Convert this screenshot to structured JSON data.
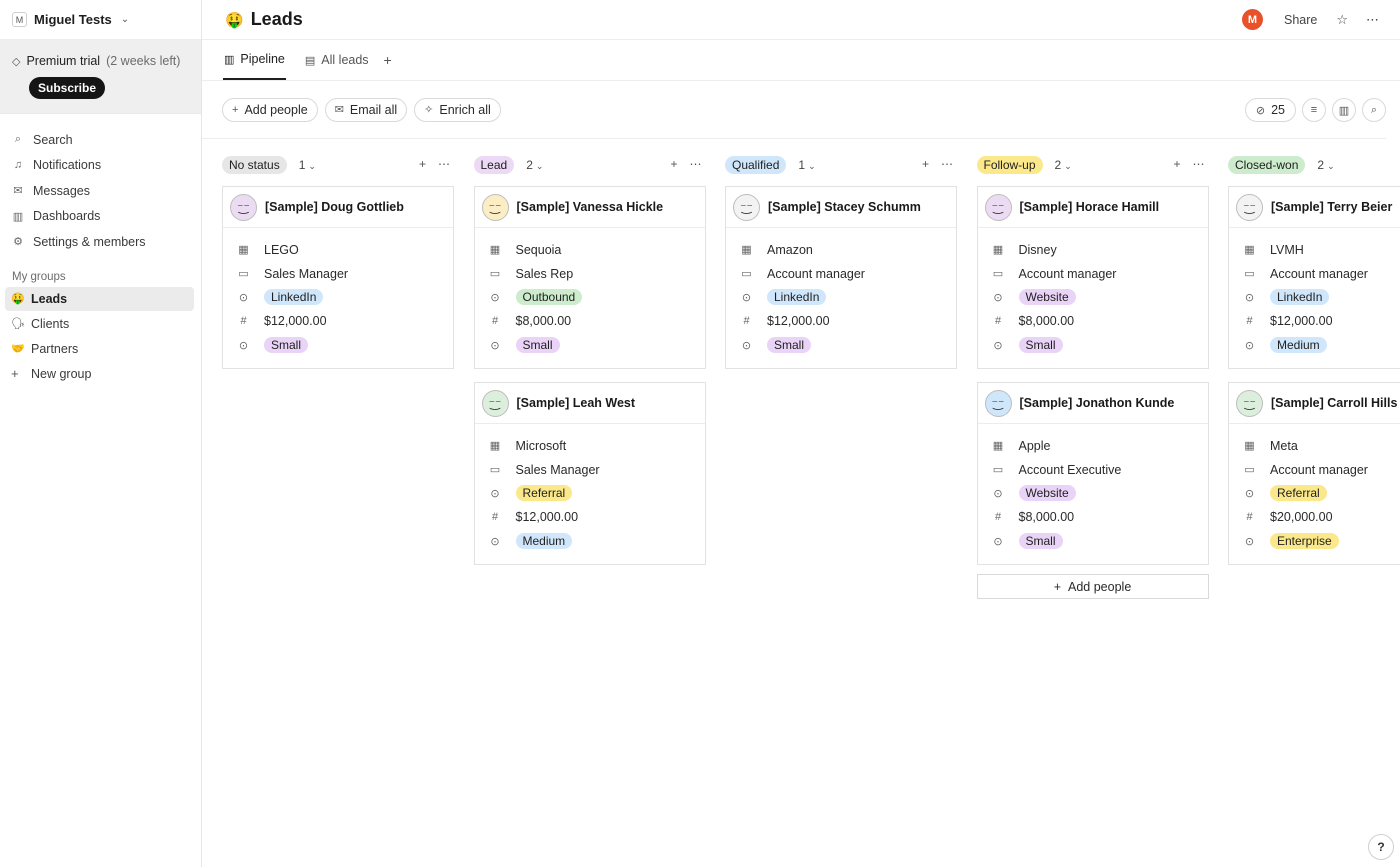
{
  "workspace": {
    "name": "Miguel Tests",
    "badge": "M"
  },
  "trial": {
    "label": "Premium trial",
    "remaining": "(2 weeks left)",
    "subscribe": "Subscribe"
  },
  "nav": [
    {
      "label": "Search",
      "icon": "search-icon",
      "glyph": "⌕"
    },
    {
      "label": "Notifications",
      "icon": "bell-icon",
      "glyph": "🔔︎"
    },
    {
      "label": "Messages",
      "icon": "mail-icon",
      "glyph": "✉"
    },
    {
      "label": "Dashboards",
      "icon": "chart-icon",
      "glyph": "▥"
    },
    {
      "label": "Settings & members",
      "icon": "gear-icon",
      "glyph": "⚙"
    }
  ],
  "groups": {
    "title": "My groups",
    "items": [
      {
        "label": "Leads",
        "emoji": "🤑"
      },
      {
        "label": "Clients",
        "emoji": "🗣"
      },
      {
        "label": "Partners",
        "emoji": "🤝"
      }
    ],
    "new_group": "New group"
  },
  "page": {
    "emoji": "🤑",
    "title": "Leads"
  },
  "topbar": {
    "avatar": "M",
    "share": "Share"
  },
  "tabs": [
    {
      "label": "Pipeline",
      "active": true
    },
    {
      "label": "All leads",
      "active": false
    }
  ],
  "toolbar": {
    "add_people": "Add people",
    "email_all": "Email all",
    "enrich_all": "Enrich all",
    "hidden_count": "25"
  },
  "columns": [
    {
      "status": "No status",
      "color": "#e6e6e6",
      "count": "1",
      "cards": [
        {
          "name": "[Sample] Doug Gottlieb",
          "avatar_bg": "#ecdcf3",
          "company": "LEGO",
          "role": "Sales Manager",
          "source": "LinkedIn",
          "source_color": "#cfe6fb",
          "amount": "$12,000.00",
          "size": "Small",
          "size_color": "#e9d3f7"
        }
      ]
    },
    {
      "status": "Lead",
      "color": "#ecd9f6",
      "count": "2",
      "cards": [
        {
          "name": "[Sample] Vanessa Hickle",
          "avatar_bg": "#fbedc4",
          "company": "Sequoia",
          "role": "Sales Rep",
          "source": "Outbound",
          "source_color": "#cdeccd",
          "amount": "$8,000.00",
          "size": "Small",
          "size_color": "#e9d3f7"
        },
        {
          "name": "[Sample] Leah West",
          "avatar_bg": "#dcefdc",
          "company": "Microsoft",
          "role": "Sales Manager",
          "source": "Referral",
          "source_color": "#fbe88a",
          "amount": "$12,000.00",
          "size": "Medium",
          "size_color": "#cfe6fb"
        }
      ]
    },
    {
      "status": "Qualified",
      "color": "#cfe6fb",
      "count": "1",
      "cards": [
        {
          "name": "[Sample] Stacey Schumm",
          "avatar_bg": "#f3f3f3",
          "company": "Amazon",
          "role": "Account manager",
          "source": "LinkedIn",
          "source_color": "#cfe6fb",
          "amount": "$12,000.00",
          "size": "Small",
          "size_color": "#e9d3f7"
        }
      ]
    },
    {
      "status": "Follow-up",
      "color": "#fbe88a",
      "count": "2",
      "cards": [
        {
          "name": "[Sample] Horace Hamill",
          "avatar_bg": "#ecdcf3",
          "company": "Disney",
          "role": "Account manager",
          "source": "Website",
          "source_color": "#e9d3f7",
          "amount": "$8,000.00",
          "size": "Small",
          "size_color": "#e9d3f7"
        },
        {
          "name": "[Sample] Jonathon Kunde",
          "avatar_bg": "#cfe6fb",
          "company": "Apple",
          "role": "Account Executive",
          "source": "Website",
          "source_color": "#e9d3f7",
          "amount": "$8,000.00",
          "size": "Small",
          "size_color": "#e9d3f7"
        }
      ],
      "add_label": "Add people"
    },
    {
      "status": "Closed-won",
      "color": "#cdeccd",
      "count": "2",
      "cards": [
        {
          "name": "[Sample] Terry Beier",
          "avatar_bg": "#f3f3f3",
          "company": "LVMH",
          "role": "Account manager",
          "source": "LinkedIn",
          "source_color": "#cfe6fb",
          "amount": "$12,000.00",
          "size": "Medium",
          "size_color": "#cfe6fb"
        },
        {
          "name": "[Sample] Carroll Hills",
          "avatar_bg": "#dcefdc",
          "company": "Meta",
          "role": "Account manager",
          "source": "Referral",
          "source_color": "#fbe88a",
          "amount": "$20,000.00",
          "size": "Enterprise",
          "size_color": "#fbe88a"
        }
      ]
    }
  ],
  "help": "?"
}
